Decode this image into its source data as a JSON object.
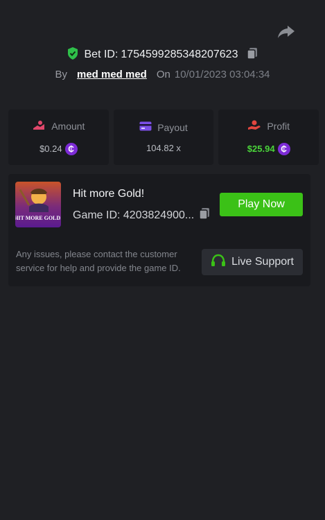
{
  "bet": {
    "label": "Bet ID:",
    "id": "1754599285348207623"
  },
  "meta": {
    "by_label": "By",
    "username": "med med med",
    "on_label": "On",
    "datetime": "10/01/2023 03:04:34"
  },
  "stats": {
    "amount": {
      "label": "Amount",
      "value": "$0.24"
    },
    "payout": {
      "label": "Payout",
      "value": "104.82 x"
    },
    "profit": {
      "label": "Profit",
      "value": "$25.94"
    }
  },
  "currency": {
    "symbol": "₵"
  },
  "game": {
    "title": "Hit more Gold!",
    "id_text": "Game ID: 4203824900...",
    "thumb_text": "HIT MORE GOLD!",
    "play_label": "Play Now",
    "notice": "Any issues, please contact the customer service for help and provide the game ID.",
    "support_label": "Live Support"
  },
  "colors": {
    "background": "#1f2024",
    "card": "#191a1e",
    "accent_green": "#3bc117",
    "profit_green": "#4ad43a",
    "coin_purple": "#7d2bd6",
    "amount_icon": "#e0476b",
    "payout_icon": "#7b4fe6",
    "profit_icon": "#e2463f"
  }
}
